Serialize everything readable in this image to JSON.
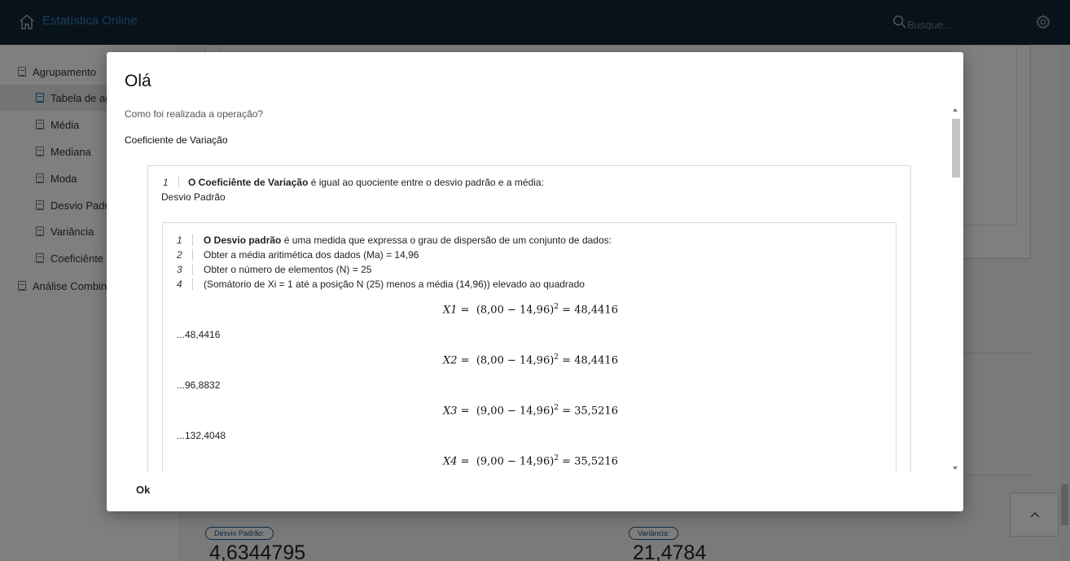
{
  "app": {
    "title": "Estatística Online",
    "search_placeholder": "Busque..."
  },
  "sidebar": {
    "items": [
      {
        "label": "Agrupamento",
        "active": false
      },
      {
        "label": "Tabela de agrupamento",
        "active": true
      },
      {
        "label": "Média",
        "active": false
      },
      {
        "label": "Mediana",
        "active": false
      },
      {
        "label": "Moda",
        "active": false
      },
      {
        "label": "Desvio Padrão",
        "active": false
      },
      {
        "label": "Variância",
        "active": false
      },
      {
        "label": "Coeficiênte de Variação",
        "active": false
      },
      {
        "label": "Análise Combinatória",
        "active": false
      }
    ]
  },
  "background": {
    "desvio_label": "Desvio Padrão:",
    "desvio_value": "4,6344795",
    "variancia_label": "Variância:",
    "variancia_value": "21,4784"
  },
  "modal": {
    "title": "Olá",
    "question": "Como foi realizada a operação?",
    "operation_title": "Coeficiente de Variação",
    "outer_step": {
      "num": "1",
      "bold": "O Coeficiênte de Variação",
      "rest": " é igual ao quociente entre o desvio padrão e a média:"
    },
    "subtitle": "Desvio Padrão",
    "inner_steps": [
      {
        "num": "1",
        "bold": "O Desvio padrão",
        "rest": " é uma medida que expressa o grau de dispersão de um conjunto de dados:"
      },
      {
        "num": "2",
        "bold": "",
        "rest": "Obter a média aritimética dos dados (Ma) = 14,96"
      },
      {
        "num": "3",
        "bold": "",
        "rest": "Obter o número de elementos (N) = 25"
      },
      {
        "num": "4",
        "bold": "",
        "rest": "(Somátorio de Xi = 1 até a posição N (25) menos a média (14,96)) elevado ao quadrado"
      }
    ],
    "formulas": [
      {
        "var": "X1",
        "expr": "(8,00 − 14,96)",
        "result": "48,4416",
        "partial": "...48,4416"
      },
      {
        "var": "X2",
        "expr": "(8,00 − 14,96)",
        "result": "48,4416",
        "partial": "...96,8832"
      },
      {
        "var": "X3",
        "expr": "(9,00 − 14,96)",
        "result": "35,5216",
        "partial": "...132,4048"
      },
      {
        "var": "X4",
        "expr": "(9,00 − 14,96)",
        "result": "35,5216",
        "partial": ""
      }
    ],
    "ok_label": "Ok"
  }
}
